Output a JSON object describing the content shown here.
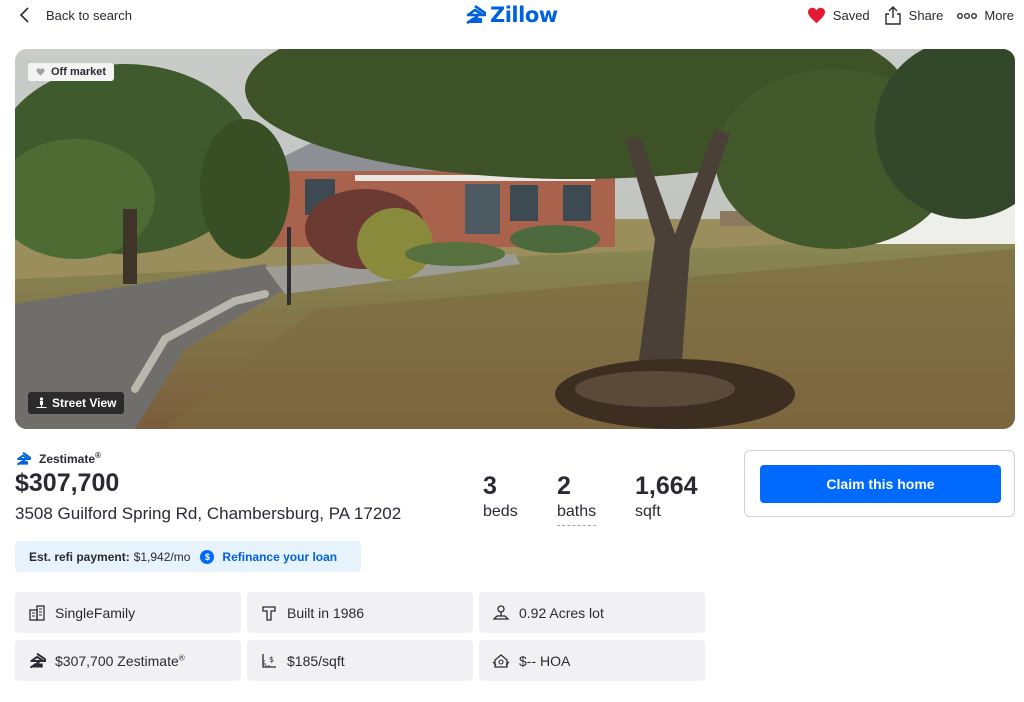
{
  "header": {
    "back_label": "Back to search",
    "logo_text": "Zillow",
    "saved_label": "Saved",
    "share_label": "Share",
    "more_label": "More"
  },
  "hero": {
    "status_badge": "Off market",
    "street_view_label": "Street View"
  },
  "summary": {
    "zestimate_label": "Zestimate",
    "zestimate_reg": "®",
    "price": "$307,700",
    "address": "3508 Guilford Spring Rd, Chambersburg, PA 17202",
    "beds_value": "3",
    "beds_label": "beds",
    "baths_value": "2",
    "baths_label": "baths",
    "sqft_value": "1,664",
    "sqft_label": "sqft"
  },
  "claim": {
    "button_label": "Claim this home"
  },
  "refi": {
    "label": "Est. refi payment:",
    "amount": "$1,942/mo",
    "link_label": "Refinance your loan"
  },
  "tiles": {
    "type": "SingleFamily",
    "built": "Built in 1986",
    "lot": "0.92 Acres lot",
    "zestimate": "$307,700 Zestimate",
    "zestimate_reg": "®",
    "price_per_sqft": "$185/sqft",
    "hoa": "$-- HOA"
  },
  "colors": {
    "brand": "#006aff",
    "text": "#2a2a33",
    "saved_heart": "#e51a32",
    "tile_bg": "#f1f1f4",
    "refi_bg": "#e6f3fc"
  },
  "icons": [
    "chevron-left-icon",
    "zillow-logo-icon",
    "heart-icon",
    "share-icon",
    "more-dots-icon",
    "street-view-icon",
    "dollar-icon",
    "house-icon",
    "hammer-icon",
    "lot-icon",
    "price-sqft-icon",
    "hoa-icon"
  ]
}
